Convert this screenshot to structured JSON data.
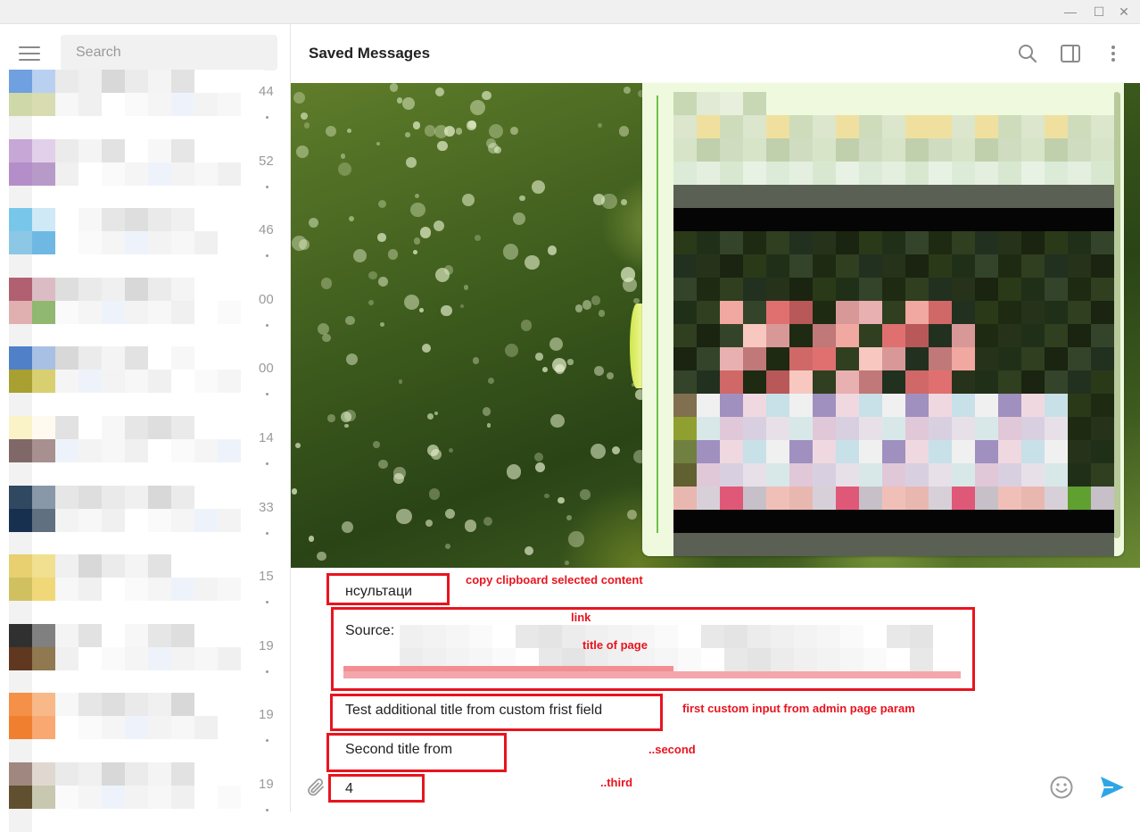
{
  "window": {
    "controls": {
      "minimize": "—",
      "maximize": "☐",
      "close": "✕"
    }
  },
  "sidebar": {
    "search_placeholder": "Search",
    "chats": [
      {
        "time": "44"
      },
      {
        "time": "52"
      },
      {
        "time": "46"
      },
      {
        "time": "00"
      },
      {
        "time": "00"
      },
      {
        "time": "14"
      },
      {
        "time": "33"
      },
      {
        "time": "15"
      },
      {
        "time": "19"
      },
      {
        "time": "19"
      },
      {
        "time": "19"
      }
    ]
  },
  "header": {
    "title": "Saved Messages",
    "icons": [
      "search-icon",
      "sidebar-toggle-icon",
      "more-vertical-icon"
    ]
  },
  "composer": {
    "clipboard_value": "нсультаци",
    "source_label": "Source:",
    "first_custom_value": "Test additional title from custom frist field",
    "second_custom_value": "Second title from",
    "third_value": "4"
  },
  "annotations": {
    "clipboard": "copy clipboard selected content",
    "link": "link",
    "title_of_page": "title of page",
    "first_custom": "first custom input from admin page param",
    "second": "..second",
    "third": "..third"
  },
  "colors": {
    "accent": "#2ea6e5",
    "annotation_red": "#e8141e",
    "bubble_bg": "#eef9dd"
  }
}
